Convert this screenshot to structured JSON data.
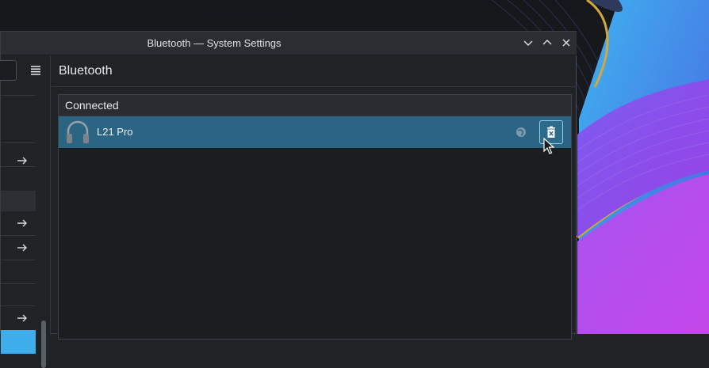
{
  "window": {
    "title": "Bluetooth — System Settings",
    "buttons": [
      "minimize",
      "maximize",
      "close"
    ]
  },
  "sidebar": {
    "items_with_arrows": 4
  },
  "page": {
    "title": "Bluetooth"
  },
  "devices": {
    "section_label": "Connected",
    "items": [
      {
        "name": "L21 Pro",
        "icon": "headphones-icon",
        "status_icon": "network-icon",
        "action_icon": "remove-icon"
      }
    ]
  },
  "colors": {
    "selection": "#2b6583",
    "accent": "#3daee9",
    "window_bg": "#202326"
  }
}
